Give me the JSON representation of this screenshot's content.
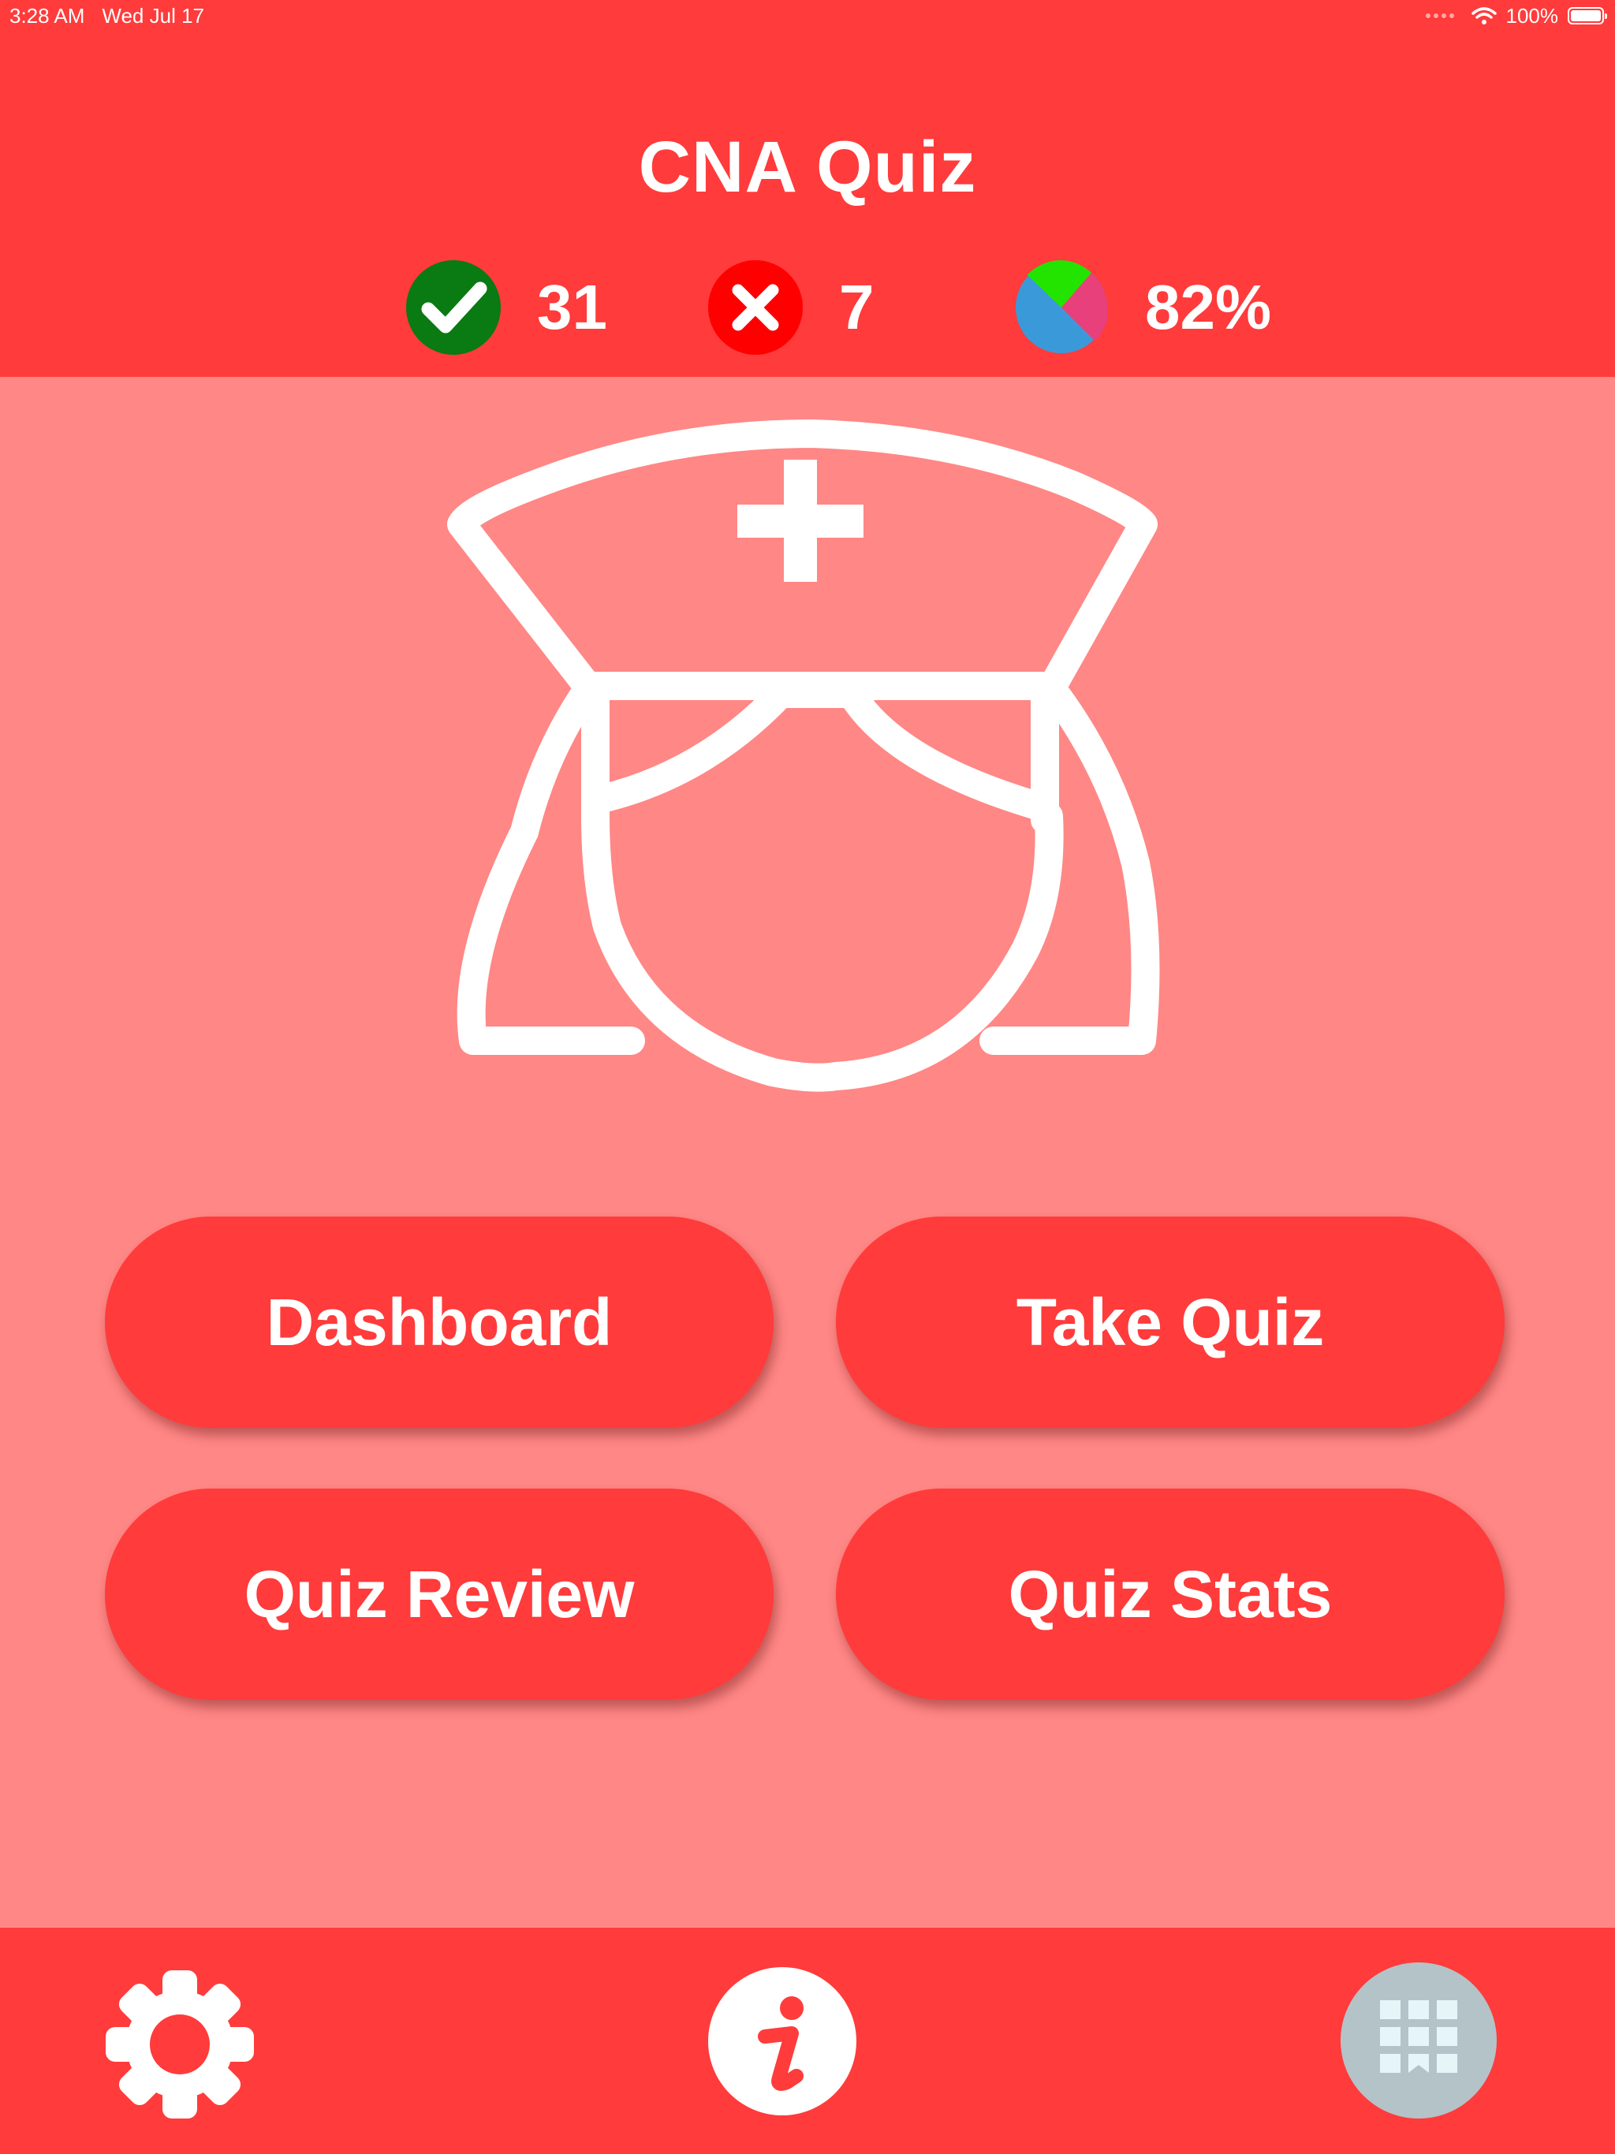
{
  "status_bar": {
    "time": "3:28 AM",
    "date": "Wed Jul 17",
    "battery": "100%"
  },
  "header": {
    "title": "CNA Quiz",
    "stats": {
      "correct": "31",
      "wrong": "7",
      "score": "82%"
    }
  },
  "icons": {
    "correct": "checkmark-icon",
    "wrong": "x-mark-icon",
    "score": "pie-chart-icon",
    "hero": "nurse-icon",
    "settings": "gear-icon",
    "info": "info-icon",
    "apps": "app-grid-icon"
  },
  "menu": {
    "dashboard": "Dashboard",
    "take_quiz": "Take Quiz",
    "quiz_review": "Quiz Review",
    "quiz_stats": "Quiz Stats"
  },
  "colors": {
    "header_bg": "#ff3b3b",
    "body_bg": "#ff8785",
    "correct_green": "#0a7a12",
    "wrong_red": "#ff0000",
    "pie_green": "#22e400",
    "pie_pink": "#e8407a",
    "pie_blue": "#3a9ad9",
    "apps_bg": "#b4c3c8"
  }
}
